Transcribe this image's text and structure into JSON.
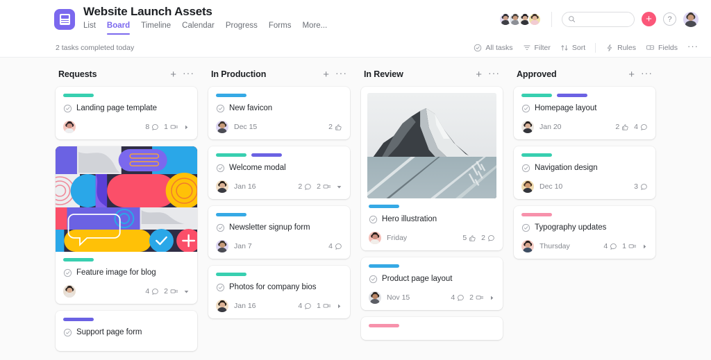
{
  "header": {
    "logo_icon": "board-app-logo-icon",
    "project_title": "Website Launch Assets",
    "tabs": [
      {
        "label": "List",
        "active": false
      },
      {
        "label": "Board",
        "active": true
      },
      {
        "label": "Timeline",
        "active": false
      },
      {
        "label": "Calendar",
        "active": false
      },
      {
        "label": "Progress",
        "active": false
      },
      {
        "label": "Forms",
        "active": false
      },
      {
        "label": "More...",
        "active": false
      }
    ],
    "members": [
      {
        "name": "member-1",
        "skin": "#caa08a",
        "hair": "#2c2c33",
        "shirt": "#3f4046",
        "bg": "#e4dcf2"
      },
      {
        "name": "member-2",
        "skin": "#c89a7d",
        "hair": "#4a4440",
        "shirt": "#8c8f96",
        "bg": "#dfe3ea"
      },
      {
        "name": "member-3",
        "skin": "#d2a98f",
        "hair": "#211f24",
        "shirt": "#33343a",
        "bg": "#f0ece4"
      },
      {
        "name": "member-4",
        "skin": "#e2b79c",
        "hair": "#3a2f28",
        "shirt": "#f2cbd2",
        "bg": "#f0e2a8"
      }
    ],
    "search": {
      "value": "",
      "placeholder": ""
    },
    "add_button_label": "+",
    "help_button_label": "?",
    "profile_avatar": {
      "name": "profile-avatar",
      "skin": "#c89a7d",
      "hair": "#3b3630",
      "shirt": "#4a4b52",
      "bg": "#ddd6f3"
    }
  },
  "toolbar": {
    "status_text": "2 tasks completed today",
    "items": [
      {
        "label": "All tasks",
        "icon": "check-circle-icon"
      },
      {
        "label": "Filter",
        "icon": "filter-icon"
      },
      {
        "label": "Sort",
        "icon": "sort-icon"
      }
    ],
    "items2": [
      {
        "label": "Rules",
        "icon": "bolt-icon"
      },
      {
        "label": "Fields",
        "icon": "fields-icon"
      }
    ],
    "overflow_label": "···"
  },
  "board": {
    "add_icon_label": "+",
    "menu_icon_label": "···",
    "colors": {
      "green": "#38cfb0",
      "blue": "#35a9e5",
      "purple": "#6b62e3",
      "pink": "#f791ab",
      "accent": "#7b68ee",
      "add_button": "#fb5779"
    },
    "columns": [
      {
        "name": "requests",
        "title": "Requests",
        "cards": [
          {
            "name": "card-landing-page-template",
            "title": "Landing page template",
            "tags": [
              "green"
            ],
            "image": null,
            "assignee": {
              "name": "assignee-avatar",
              "skin": "#cf9486",
              "hair": "#2a2226",
              "shirt": "#edeef0",
              "bg": "#f6c8c0"
            },
            "date": "",
            "meta": [
              {
                "icon": "comment-icon",
                "value": "8"
              },
              {
                "icon": "subtask-icon",
                "value": "1"
              }
            ],
            "trailing_icon": "caret-right-icon"
          },
          {
            "name": "card-feature-image-for-blog",
            "title": "Feature image for blog",
            "tags": [
              "green"
            ],
            "image": "abstract-collage",
            "assignee": {
              "name": "assignee-avatar",
              "skin": "#d8ab8e",
              "hair": "#2b2320",
              "shirt": "#e9e4df",
              "bg": "#e8ded2"
            },
            "date": "",
            "meta": [
              {
                "icon": "comment-icon",
                "value": "4"
              },
              {
                "icon": "subtask-icon",
                "value": "2"
              }
            ],
            "trailing_icon": "caret-down-icon"
          },
          {
            "name": "card-support-page-form",
            "title": "Support page form",
            "tags": [
              "purple"
            ],
            "image": null,
            "assignee": null,
            "date": "",
            "meta": [],
            "trailing_icon": null
          }
        ]
      },
      {
        "name": "in-production",
        "title": "In Production",
        "cards": [
          {
            "name": "card-new-favicon",
            "title": "New favicon",
            "tags": [
              "blue"
            ],
            "image": null,
            "assignee": {
              "name": "assignee-avatar",
              "skin": "#c79a79",
              "hair": "#3b332c",
              "shirt": "#4b4c54",
              "bg": "#ddd6f3"
            },
            "date": "Dec 15",
            "meta": [
              {
                "icon": "thumbs-up-icon",
                "value": "2"
              }
            ],
            "trailing_icon": null
          },
          {
            "name": "card-welcome-modal",
            "title": "Welcome modal",
            "tags": [
              "green",
              "purple"
            ],
            "image": null,
            "assignee": {
              "name": "assignee-avatar",
              "skin": "#dcb295",
              "hair": "#2a2119",
              "shirt": "#3a3b42",
              "bg": "#f2dfc7"
            },
            "date": "Jan 16",
            "meta": [
              {
                "icon": "comment-icon",
                "value": "2"
              },
              {
                "icon": "subtask-icon",
                "value": "2"
              }
            ],
            "trailing_icon": "caret-down-icon"
          },
          {
            "name": "card-newsletter-signup-form",
            "title": "Newsletter signup form",
            "tags": [
              "blue"
            ],
            "image": null,
            "assignee": {
              "name": "assignee-avatar",
              "skin": "#c79a79",
              "hair": "#3b332c",
              "shirt": "#4b4c54",
              "bg": "#ddd6f3"
            },
            "date": "Jan 7",
            "meta": [
              {
                "icon": "comment-icon",
                "value": "4"
              }
            ],
            "trailing_icon": null
          },
          {
            "name": "card-photos-for-company-bios",
            "title": "Photos for company bios",
            "tags": [
              "green"
            ],
            "image": null,
            "assignee": {
              "name": "assignee-avatar",
              "skin": "#dcb295",
              "hair": "#2a2119",
              "shirt": "#3a3b42",
              "bg": "#f2dfc7"
            },
            "date": "Jan 16",
            "meta": [
              {
                "icon": "comment-icon",
                "value": "4"
              },
              {
                "icon": "subtask-icon",
                "value": "1"
              }
            ],
            "trailing_icon": "caret-right-icon"
          }
        ]
      },
      {
        "name": "in-review",
        "title": "In Review",
        "cards": [
          {
            "name": "card-hero-illustration",
            "title": "Hero illustration",
            "tags": [
              "blue"
            ],
            "image": "mountain-photo",
            "assignee": {
              "name": "assignee-avatar",
              "skin": "#c98d7e",
              "hair": "#29211d",
              "shirt": "#f1eeea",
              "bg": "#f4bfb8"
            },
            "date": "Friday",
            "meta": [
              {
                "icon": "thumbs-up-icon",
                "value": "5"
              },
              {
                "icon": "comment-icon",
                "value": "2"
              }
            ],
            "trailing_icon": null
          },
          {
            "name": "card-product-page-layout",
            "title": "Product page layout",
            "tags": [
              "blue"
            ],
            "image": null,
            "assignee": {
              "name": "assignee-avatar",
              "skin": "#b98463",
              "hair": "#2f2722",
              "shirt": "#5b5d64",
              "bg": "#dfe1e5"
            },
            "date": "Nov 15",
            "meta": [
              {
                "icon": "comment-icon",
                "value": "4"
              },
              {
                "icon": "subtask-icon",
                "value": "2"
              }
            ],
            "trailing_icon": "caret-right-icon"
          },
          {
            "name": "card-in-review-partial",
            "title": "",
            "tags": [
              "pink"
            ],
            "image": null,
            "assignee": null,
            "date": "",
            "meta": [],
            "trailing_icon": null
          }
        ]
      },
      {
        "name": "approved",
        "title": "Approved",
        "cards": [
          {
            "name": "card-homepage-layout",
            "title": "Homepage layout",
            "tags": [
              "green",
              "purple"
            ],
            "image": null,
            "assignee": {
              "name": "assignee-avatar",
              "skin": "#dbb49a",
              "hair": "#24201e",
              "shirt": "#34353b",
              "bg": "#ece7e1"
            },
            "date": "Jan 20",
            "meta": [
              {
                "icon": "thumbs-up-icon",
                "value": "2"
              },
              {
                "icon": "comment-icon",
                "value": "4"
              }
            ],
            "trailing_icon": null
          },
          {
            "name": "card-navigation-design",
            "title": "Navigation design",
            "tags": [
              "green"
            ],
            "image": null,
            "assignee": {
              "name": "assignee-avatar",
              "skin": "#d39d72",
              "hair": "#4a3524",
              "shirt": "#33353c",
              "bg": "#f0dcb0"
            },
            "date": "Dec 10",
            "meta": [
              {
                "icon": "comment-icon",
                "value": "3"
              }
            ],
            "trailing_icon": null
          },
          {
            "name": "card-typography-updates",
            "title": "Typography updates",
            "tags": [
              "pink"
            ],
            "image": null,
            "assignee": {
              "name": "assignee-avatar",
              "skin": "#d8a58d",
              "hair": "#241c1b",
              "shirt": "#3d4e63",
              "bg": "#f6cfc7"
            },
            "date": "Thursday",
            "meta": [
              {
                "icon": "comment-icon",
                "value": "4"
              },
              {
                "icon": "subtask-icon",
                "value": "1"
              }
            ],
            "trailing_icon": "caret-right-icon"
          }
        ]
      }
    ]
  }
}
